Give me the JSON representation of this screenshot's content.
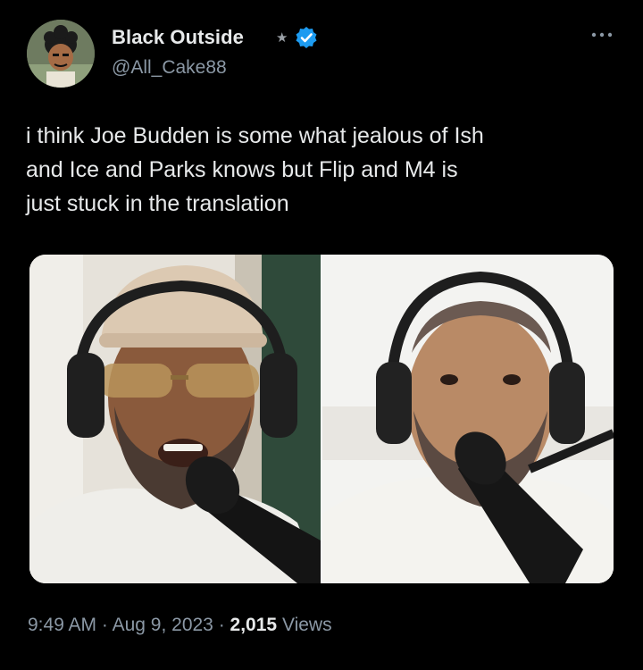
{
  "author": {
    "display_name": "Black Outside",
    "handle": "@All_Cake88",
    "badge_icon": "star-icon",
    "verified_icon": "verified-badge-icon",
    "verified_color": "#1d9bf0"
  },
  "menu": {
    "icon": "more-options-icon"
  },
  "tweet": {
    "text": "i think Joe Budden is some what jealous of Ish\nand Ice and Parks knows but Flip and M4 is\njust stuck in the translation"
  },
  "media": {
    "panels": [
      {
        "subject": "man in beige cap and headphones speaking into microphone"
      },
      {
        "subject": "man in headphones speaking into microphone"
      }
    ]
  },
  "meta": {
    "time": "9:49 AM",
    "separator": "·",
    "date": "Aug 9, 2023",
    "views_count": "2,015",
    "views_label": "Views"
  }
}
